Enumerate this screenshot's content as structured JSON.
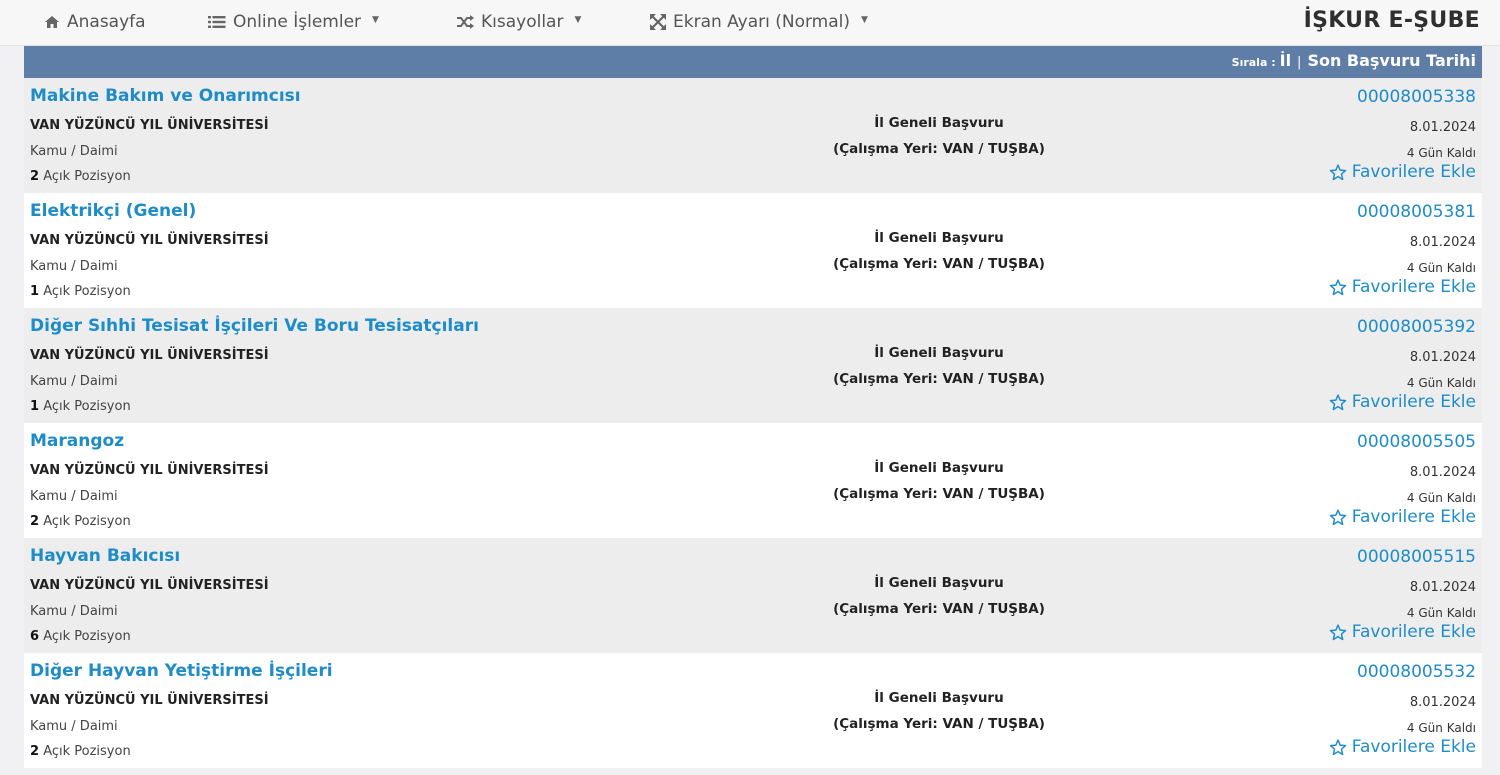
{
  "nav": {
    "home": "Anasayfa",
    "online": "Online İşlemler",
    "shortcuts": "Kısayollar",
    "screen": "Ekran Ayarı (Normal)"
  },
  "brand": "İŞKUR E-ŞUBE",
  "sort": {
    "label": "Sırala :",
    "option1": "İl",
    "separator": "|",
    "option2": "Son Başvuru Tarihi"
  },
  "jobs": [
    {
      "title": "Makine Bakım ve Onarımcısı",
      "employer": "VAN YÜZÜNCÜ YIL ÜNİVERSİTESİ",
      "type": "Kamu / Daimi",
      "count": "2",
      "count_label": "Açık Pozisyon",
      "scope": "İl Geneli Başvuru",
      "location": "(Çalışma Yeri: VAN / TUŞBA)",
      "code": "00008005338",
      "date": "8.01.2024",
      "remaining": "4 Gün Kaldı",
      "fav": "Favorilere Ekle"
    },
    {
      "title": "Elektrikçi (Genel)",
      "employer": "VAN YÜZÜNCÜ YIL ÜNİVERSİTESİ",
      "type": "Kamu / Daimi",
      "count": "1",
      "count_label": "Açık Pozisyon",
      "scope": "İl Geneli Başvuru",
      "location": "(Çalışma Yeri: VAN / TUŞBA)",
      "code": "00008005381",
      "date": "8.01.2024",
      "remaining": "4 Gün Kaldı",
      "fav": "Favorilere Ekle"
    },
    {
      "title": "Diğer Sıhhi Tesisat İşçileri Ve Boru Tesisatçıları",
      "employer": "VAN YÜZÜNCÜ YIL ÜNİVERSİTESİ",
      "type": "Kamu / Daimi",
      "count": "1",
      "count_label": "Açık Pozisyon",
      "scope": "İl Geneli Başvuru",
      "location": "(Çalışma Yeri: VAN / TUŞBA)",
      "code": "00008005392",
      "date": "8.01.2024",
      "remaining": "4 Gün Kaldı",
      "fav": "Favorilere Ekle"
    },
    {
      "title": "Marangoz",
      "employer": "VAN YÜZÜNCÜ YIL ÜNİVERSİTESİ",
      "type": "Kamu / Daimi",
      "count": "2",
      "count_label": "Açık Pozisyon",
      "scope": "İl Geneli Başvuru",
      "location": "(Çalışma Yeri: VAN / TUŞBA)",
      "code": "00008005505",
      "date": "8.01.2024",
      "remaining": "4 Gün Kaldı",
      "fav": "Favorilere Ekle"
    },
    {
      "title": "Hayvan Bakıcısı",
      "employer": "VAN YÜZÜNCÜ YIL ÜNİVERSİTESİ",
      "type": "Kamu / Daimi",
      "count": "6",
      "count_label": "Açık Pozisyon",
      "scope": "İl Geneli Başvuru",
      "location": "(Çalışma Yeri: VAN / TUŞBA)",
      "code": "00008005515",
      "date": "8.01.2024",
      "remaining": "4 Gün Kaldı",
      "fav": "Favorilere Ekle"
    },
    {
      "title": "Diğer Hayvan Yetiştirme İşçileri",
      "employer": "VAN YÜZÜNCÜ YIL ÜNİVERSİTESİ",
      "type": "Kamu / Daimi",
      "count": "2",
      "count_label": "Açık Pozisyon",
      "scope": "İl Geneli Başvuru",
      "location": "(Çalışma Yeri: VAN / TUŞBA)",
      "code": "00008005532",
      "date": "8.01.2024",
      "remaining": "4 Gün Kaldı",
      "fav": "Favorilere Ekle"
    }
  ]
}
